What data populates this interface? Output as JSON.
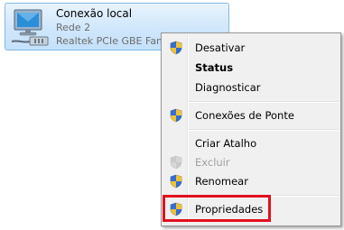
{
  "connection": {
    "name": "Conexão local",
    "network": "Rede  2",
    "adapter": "Realtek PCIe GBE Family Controller",
    "icon": "network-adapter-icon"
  },
  "context_menu": {
    "items": [
      {
        "label": "Desativar",
        "icon": "uac-shield-icon"
      },
      {
        "label": "Status"
      },
      {
        "label": "Diagnosticar"
      },
      {
        "label": "Conexões de Ponte",
        "icon": "uac-shield-icon"
      },
      {
        "label": "Criar Atalho"
      },
      {
        "label": "Excluir",
        "icon": "uac-shield-icon"
      },
      {
        "label": "Renomear",
        "icon": "uac-shield-icon"
      },
      {
        "label": "Propriedades",
        "icon": "uac-shield-icon"
      }
    ],
    "highlight_color": "#e1111e"
  }
}
